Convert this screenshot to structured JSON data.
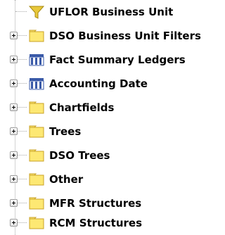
{
  "tree": {
    "items": [
      {
        "label": "UFLOR Business Unit",
        "icon": "filter-icon",
        "expandable": false
      },
      {
        "label": "DSO Business Unit Filters",
        "icon": "folder-icon",
        "expandable": true
      },
      {
        "label": "Fact Summary Ledgers",
        "icon": "table-icon",
        "expandable": true
      },
      {
        "label": "Accounting Date",
        "icon": "table-icon",
        "expandable": true
      },
      {
        "label": "Chartfields",
        "icon": "folder-icon",
        "expandable": true
      },
      {
        "label": "Trees",
        "icon": "folder-icon",
        "expandable": true
      },
      {
        "label": "DSO Trees",
        "icon": "folder-icon",
        "expandable": true
      },
      {
        "label": "Other",
        "icon": "folder-icon",
        "expandable": true
      },
      {
        "label": "MFR Structures",
        "icon": "folder-icon",
        "expandable": true
      },
      {
        "label": "RCM Structures",
        "icon": "folder-icon",
        "expandable": true
      }
    ]
  },
  "colors": {
    "folder_fill": "#fde873",
    "folder_outline": "#c9a227",
    "filter_fill": "#e8c83a",
    "table_blue": "#3a5aa8"
  }
}
